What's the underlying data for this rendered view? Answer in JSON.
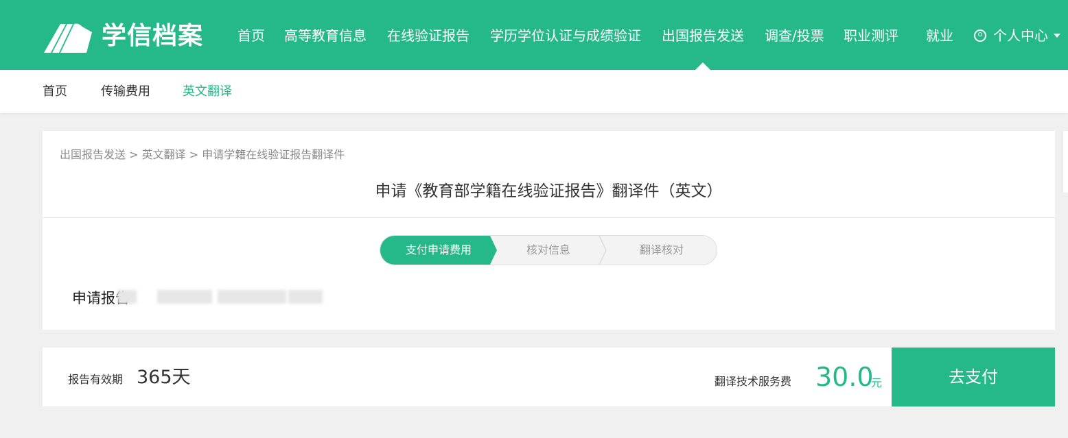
{
  "header": {
    "logo_text": "学信档案",
    "nav": [
      {
        "label": "首页"
      },
      {
        "label": "高等教育信息"
      },
      {
        "label": "在线验证报告"
      },
      {
        "label": "学历学位认证与成绩验证"
      },
      {
        "label": "出国报告发送"
      },
      {
        "label": "调查/投票"
      },
      {
        "label": "职业测评"
      },
      {
        "label": "就业"
      }
    ],
    "user_menu_label": "个人中心",
    "active_nav": "出国报告发送"
  },
  "subnav": {
    "items": [
      {
        "label": "首页"
      },
      {
        "label": "传输费用"
      },
      {
        "label": "英文翻译"
      }
    ],
    "active": "英文翻译"
  },
  "main": {
    "breadcrumb": [
      "出国报告发送",
      "英文翻译",
      "申请学籍在线验证报告翻译件"
    ],
    "breadcrumb_separator": ">",
    "title": "申请《教育部学籍在线验证报告》翻译件（英文）",
    "steps": [
      {
        "label": "支付申请费用",
        "active": true
      },
      {
        "label": "核对信息",
        "active": false
      },
      {
        "label": "翻译核对",
        "active": false
      }
    ],
    "apply_report_label": "申请报告"
  },
  "footer": {
    "validity_label": "报告有效期",
    "validity_value": "365天",
    "fee_label": "翻译技术服务费",
    "fee_amount": "30.0",
    "fee_unit": "元",
    "pay_button_label": "去支付"
  },
  "colors": {
    "brand_green": "#25b98a",
    "background": "#f0f0f0"
  }
}
